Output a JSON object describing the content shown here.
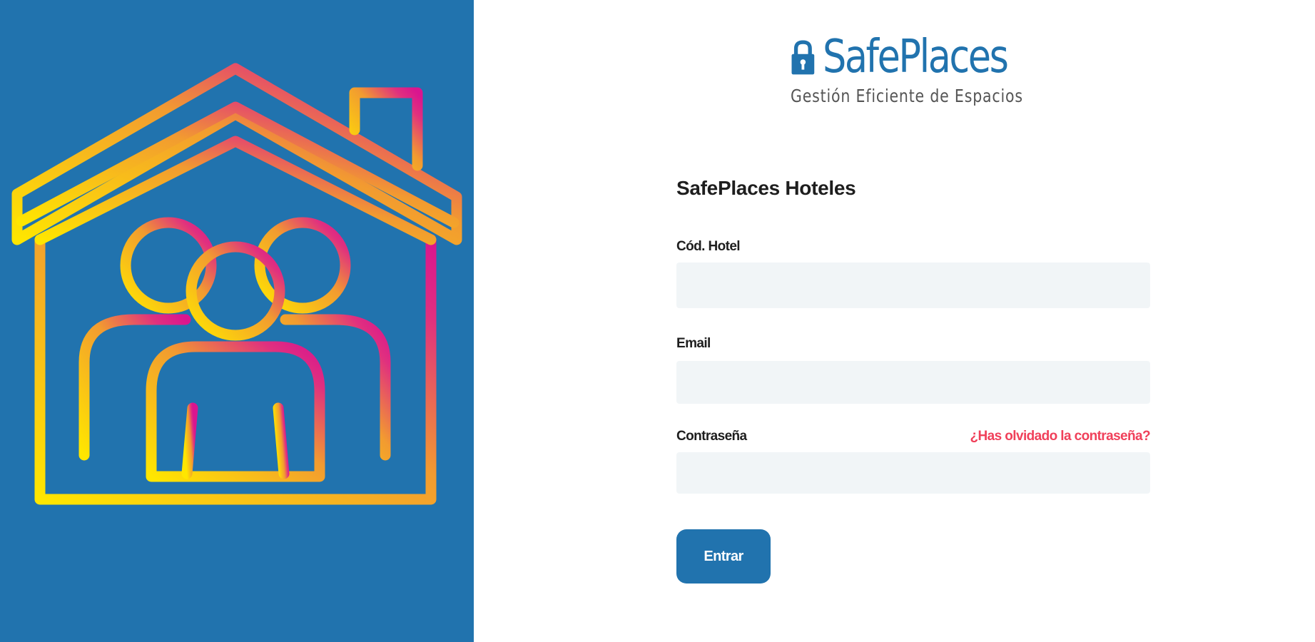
{
  "colors": {
    "left_panel_bg": "#2173AE",
    "brand_blue": "#2173AE",
    "tagline_gray": "#555555",
    "text_dark": "#1e1e1e",
    "input_bg": "#F1F5F7",
    "link_red": "#F0405A",
    "button_bg": "#2173AE",
    "button_text": "#ffffff",
    "gradient_yellow": "#FFE600",
    "gradient_orange": "#F29B30",
    "gradient_pink": "#E0307F",
    "gradient_magenta": "#D9158F"
  },
  "illustration": {
    "icon": "house-family-icon"
  },
  "brand": {
    "icon": "lock-icon",
    "name": "SafePlaces",
    "tagline": "Gestión Eficiente de Espacios"
  },
  "form": {
    "title": "SafePlaces Hoteles",
    "hotel_code": {
      "label": "Cód. Hotel",
      "value": "",
      "placeholder": ""
    },
    "email": {
      "label": "Email",
      "value": "",
      "placeholder": ""
    },
    "password": {
      "label": "Contraseña",
      "value": "",
      "placeholder": "",
      "forgot_link": "¿Has olvidado la contraseña?"
    },
    "submit_label": "Entrar"
  }
}
